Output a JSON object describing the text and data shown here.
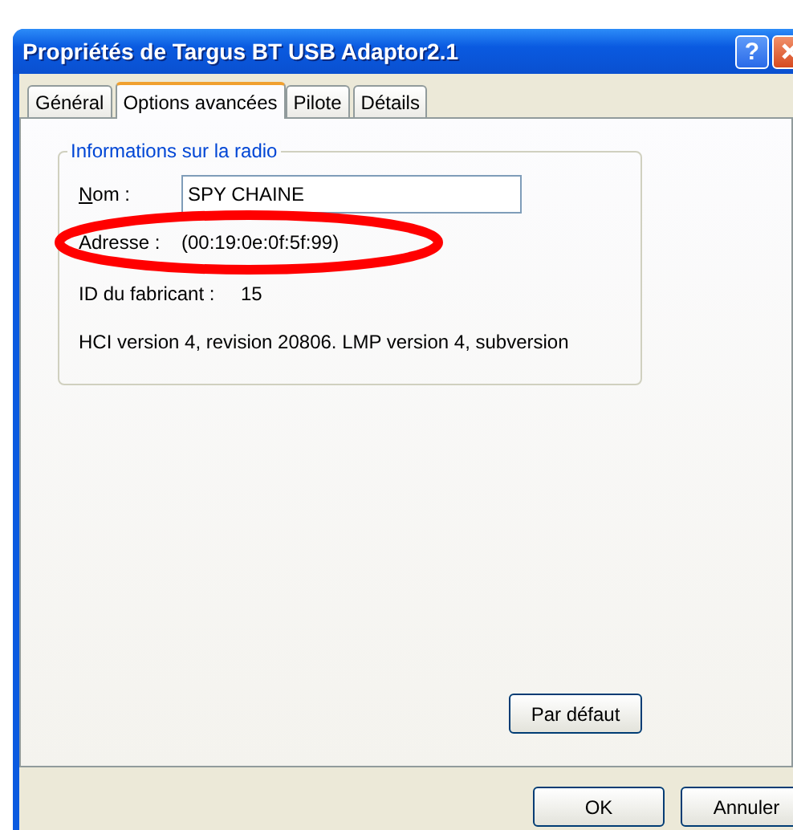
{
  "window": {
    "title": "Propriétés de Targus BT USB Adaptor2.1",
    "help_button": "?"
  },
  "tabs": [
    {
      "label": "Général",
      "selected": false
    },
    {
      "label": "Options avancées",
      "selected": true
    },
    {
      "label": "Pilote",
      "selected": false
    },
    {
      "label": "Détails",
      "selected": false
    }
  ],
  "group": {
    "title": "Informations sur la radio",
    "name_field": {
      "label": "Nom :",
      "value": "SPY CHAINE"
    },
    "address": {
      "label": "Adresse :",
      "value": "(00:19:0e:0f:5f:99)"
    },
    "manufacturer": {
      "label": "ID du fabricant :",
      "value": "15"
    },
    "version_info": "HCI version 4, revision 20806.  LMP version 4, subversion"
  },
  "defaults_button": "Par défaut",
  "buttons": [
    "OK",
    "Annuler"
  ],
  "annotation": {
    "kind": "ellipse"
  }
}
